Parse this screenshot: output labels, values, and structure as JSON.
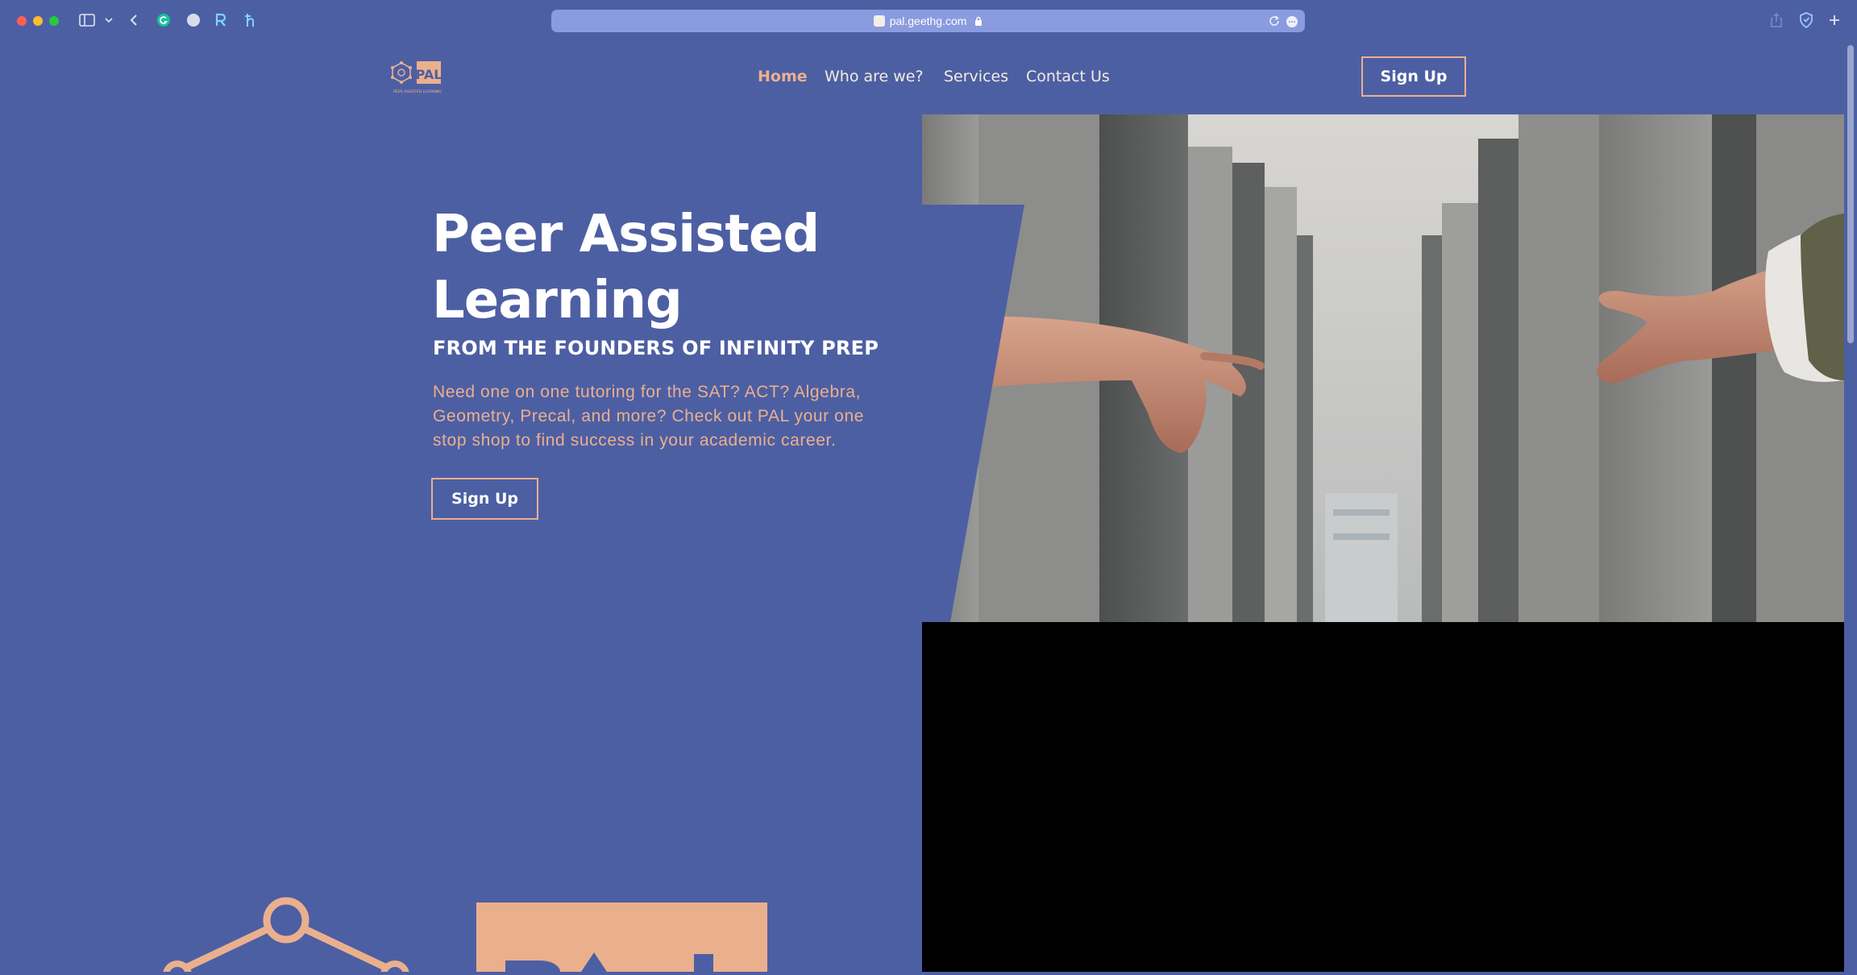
{
  "browser": {
    "url": "pal.geethg.com"
  },
  "site": {
    "logo_text": "PAL",
    "logo_tagline": "PEER ASSISTED LEARNING",
    "nav": [
      {
        "label": "Home",
        "active": true
      },
      {
        "label": "Who are we?",
        "active": false
      },
      {
        "label": "Services",
        "active": false
      },
      {
        "label": "Contact Us",
        "active": false
      }
    ],
    "signup_label": "Sign Up"
  },
  "hero": {
    "title": "Peer Assisted Learning",
    "subtitle": "FROM THE FOUNDERS OF INFINITY PREP",
    "description": "Need one on one tutoring for the SAT? ACT? Algebra, Geometry, Precal, and more? Check out PAL your one stop shop to find success in your academic career.",
    "cta_label": "Sign Up"
  },
  "colors": {
    "background": "#4d5fa3",
    "accent": "#eab08e",
    "text": "#ffffff"
  }
}
